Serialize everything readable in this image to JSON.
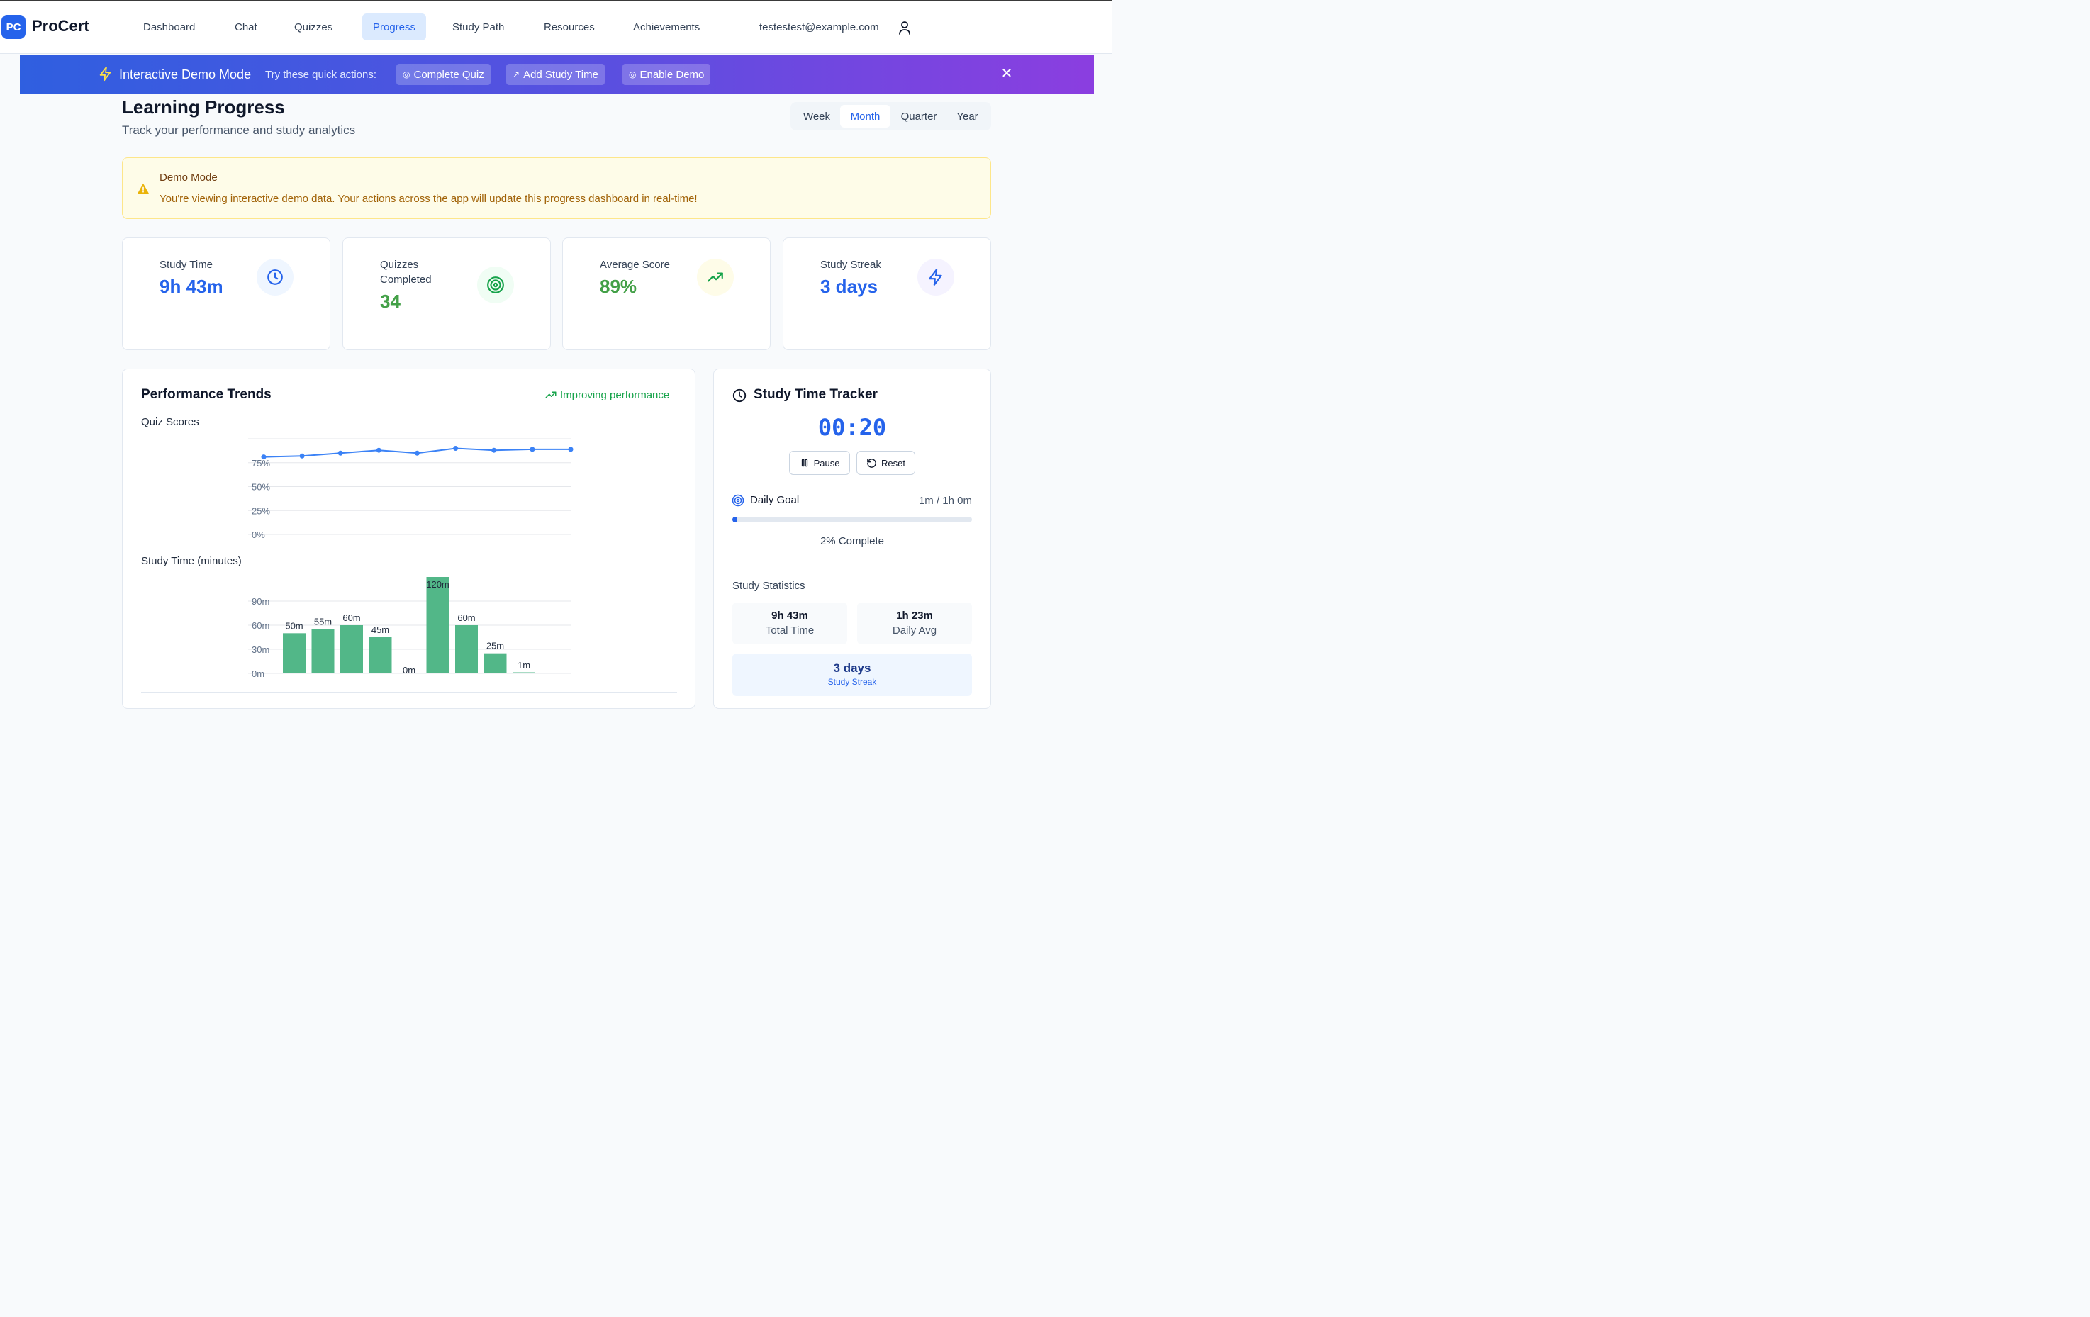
{
  "app": {
    "logo_badge": "PC",
    "name": "ProCert"
  },
  "nav": {
    "items": [
      {
        "label": "Dashboard"
      },
      {
        "label": "Chat"
      },
      {
        "label": "Quizzes"
      },
      {
        "label": "Progress",
        "active": true
      },
      {
        "label": "Study Path"
      },
      {
        "label": "Resources"
      },
      {
        "label": "Achievements"
      }
    ],
    "user_email": "testestest@example.com"
  },
  "demo_banner": {
    "title": "Interactive Demo Mode",
    "hint": "Try these quick actions:",
    "actions": [
      {
        "label": "Complete Quiz",
        "icon": "target-icon"
      },
      {
        "label": "Add Study Time",
        "icon": "trend-up-icon"
      },
      {
        "label": "Enable Demo",
        "icon": "target-icon"
      }
    ],
    "close_icon": "close-icon"
  },
  "header": {
    "title": "Learning Progress",
    "subtitle": "Track your performance and study analytics"
  },
  "period_tabs": {
    "items": [
      "Week",
      "Month",
      "Quarter",
      "Year"
    ],
    "selected": "Month"
  },
  "alert": {
    "title": "Demo Mode",
    "body": "You're viewing interactive demo data. Your actions across the app will update this progress dashboard in real-time!"
  },
  "stats": [
    {
      "label": "Study Time",
      "value": "9h 43m",
      "icon": "clock-icon",
      "color": "#2563eb"
    },
    {
      "label": "Quizzes\nCompleted",
      "value": "34",
      "icon": "target-icon",
      "color": "#16a34a"
    },
    {
      "label": "Average Score",
      "value": "89%",
      "icon": "trend-up-icon",
      "color": "#16a34a"
    },
    {
      "label": "Study Streak",
      "value": "3 days",
      "icon": "bolt-icon",
      "color": "#2563eb"
    }
  ],
  "performance": {
    "title": "Performance Trends",
    "trend_note": "Improving performance",
    "quiz_chart_title": "Quiz Scores",
    "study_chart_title": "Study Time (minutes)"
  },
  "chart_data": [
    {
      "type": "line",
      "title": "Quiz Scores",
      "y_ticks": [
        "0%",
        "25%",
        "50%",
        "75%"
      ],
      "ylim": [
        0,
        100
      ],
      "values": [
        81,
        82,
        85,
        88,
        85,
        90,
        88,
        89,
        89
      ],
      "color": "#3b82f6",
      "grid": true
    },
    {
      "type": "bar",
      "title": "Study Time (minutes)",
      "y_ticks": [
        "0m",
        "30m",
        "60m",
        "90m"
      ],
      "ylim": [
        0,
        120
      ],
      "values": [
        50,
        55,
        60,
        45,
        0,
        120,
        60,
        25,
        1
      ],
      "data_labels": [
        "50m",
        "55m",
        "60m",
        "45m",
        "0m",
        "120m",
        "60m",
        "25m",
        "1m"
      ],
      "color": "#52b788",
      "grid": true
    }
  ],
  "tracker": {
    "title": "Study Time Tracker",
    "timer": "00:20",
    "pause_label": "Pause",
    "reset_label": "Reset",
    "goal_label": "Daily Goal",
    "goal_value": "1m / 1h 0m",
    "goal_progress": 0.02,
    "goal_pct_label": "2% Complete",
    "stats_heading": "Study Statistics",
    "total_value": "9h 43m",
    "total_label": "Total Time",
    "avg_value": "1h 23m",
    "avg_label": "Daily Avg",
    "streak_value": "3 days",
    "streak_label": "Study Streak"
  }
}
